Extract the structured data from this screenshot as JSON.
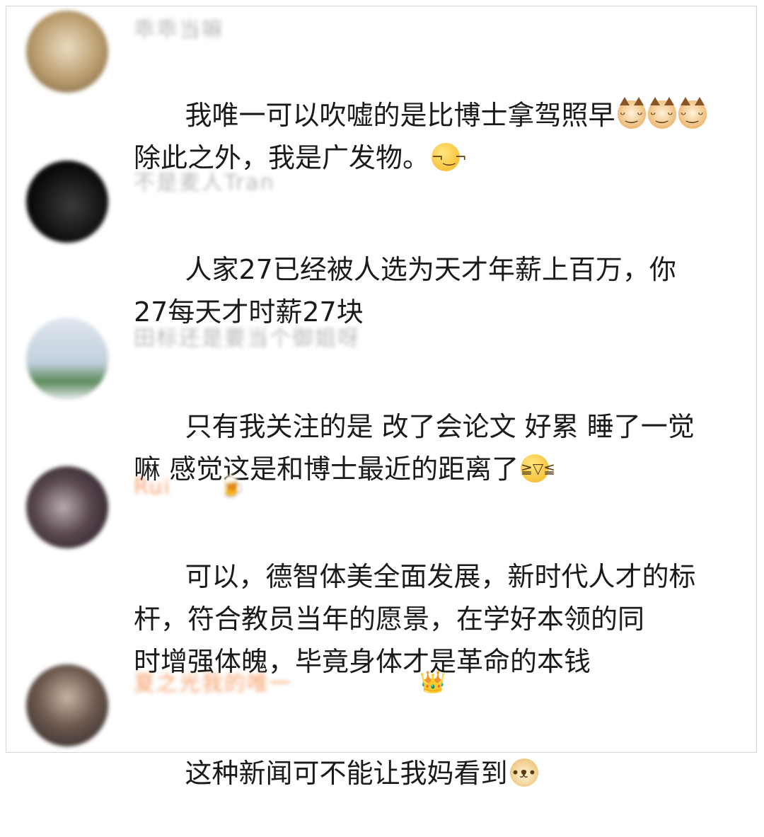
{
  "comments": [
    {
      "username": "乖乖当嘛",
      "text": "我唯一可以吹嘘的是比博士拿驾照早",
      "text_line2": "除此之外，我是广发物。",
      "emoji_after_line1": [
        "cat-icon",
        "cat-icon",
        "cat-icon"
      ],
      "emoji_after_line2": "smirk-icon",
      "avatar_color": "#c9b48c"
    },
    {
      "username": "不是麦人Tran",
      "text": "人家27已经被人选为天才年薪上百万，你",
      "text_line2": "27每天才时薪27块",
      "avatar_color": "#151515"
    },
    {
      "username": "田标还是要当个御姐呀",
      "text": "只有我关注的是 改了会论文 好累 睡了一觉",
      "text_line2": "嘛 感觉这是和博士最近的距离了",
      "emoji_after_line2": "laugh-cry-icon",
      "avatar_color": "#b7c8d8"
    },
    {
      "username": "Rui",
      "badge": "beer-icon",
      "text": "可以，德智体美全面发展，新时代人才的标",
      "text_line2": "杆，符合教员当年的愿景，在学好本领的同",
      "text_line3": "时增强体魄，毕竟身体才是革命的本钱",
      "avatar_color": "#4a3a44"
    },
    {
      "username": "夏之光我的唯一",
      "badge": "crown-icon",
      "text": "这种新闻可不能让我妈看到",
      "emoji_after_line1_single": "doge-icon",
      "avatar_color": "#3a3230"
    }
  ]
}
